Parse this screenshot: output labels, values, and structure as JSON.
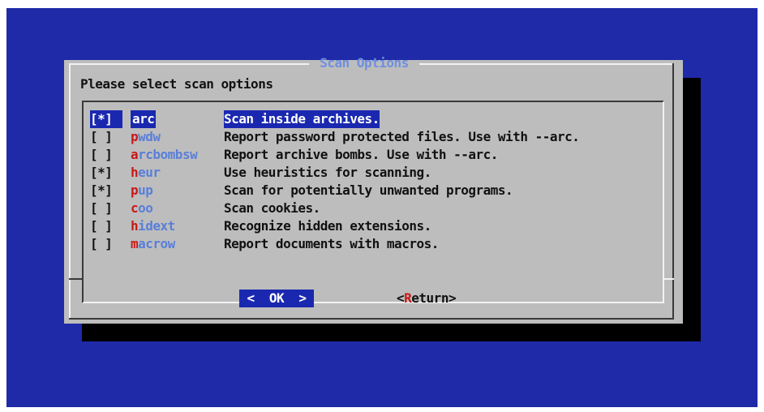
{
  "dialog": {
    "title": "Scan Options",
    "prompt": "Please select scan options"
  },
  "options": [
    {
      "checkbox": "[*]",
      "tag_first": "a",
      "tag_rest": "rc",
      "description": "Scan inside archives.",
      "checked": true,
      "selected": true
    },
    {
      "checkbox": "[ ]",
      "tag_first": "p",
      "tag_rest": "wdw",
      "description": "Report password protected files. Use with --arc.",
      "checked": false,
      "selected": false
    },
    {
      "checkbox": "[ ]",
      "tag_first": "a",
      "tag_rest": "rcbombsw",
      "description": "Report archive bombs. Use with --arc.",
      "checked": false,
      "selected": false
    },
    {
      "checkbox": "[*]",
      "tag_first": "h",
      "tag_rest": "eur",
      "description": "Use heuristics for scanning.",
      "checked": true,
      "selected": false
    },
    {
      "checkbox": "[*]",
      "tag_first": "p",
      "tag_rest": "up",
      "description": "Scan for potentially unwanted programs.",
      "checked": true,
      "selected": false
    },
    {
      "checkbox": "[ ]",
      "tag_first": "c",
      "tag_rest": "oo",
      "description": "Scan cookies.",
      "checked": false,
      "selected": false
    },
    {
      "checkbox": "[ ]",
      "tag_first": "h",
      "tag_rest": "idext",
      "description": "Recognize hidden extensions.",
      "checked": false,
      "selected": false
    },
    {
      "checkbox": "[ ]",
      "tag_first": "m",
      "tag_rest": "acrow",
      "description": "Report documents with macros.",
      "checked": false,
      "selected": false
    }
  ],
  "buttons": {
    "ok_left": "<  ",
    "ok_hot": "OK",
    "ok_right": "  >",
    "return_left": "<",
    "return_hot": "R",
    "return_rest": "eturn>"
  },
  "colors": {
    "console_background": "#1e2aa8",
    "dialog_background": "#bdbdbd",
    "highlight": "#1a28b0",
    "title": "#6f8fe0",
    "tag": "#5a7fd8",
    "hotkey": "#c81818"
  }
}
